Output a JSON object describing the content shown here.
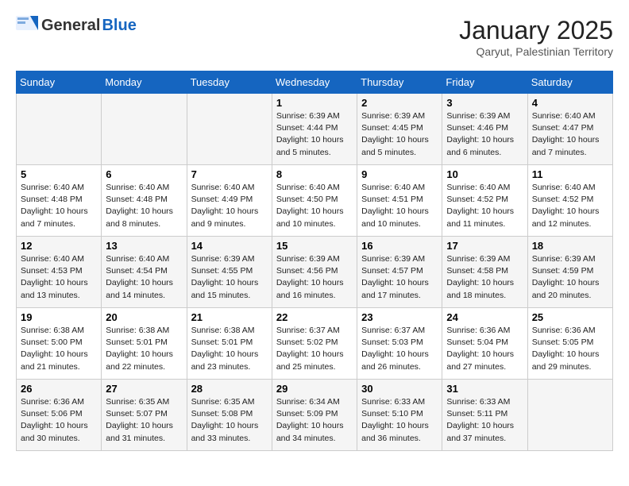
{
  "header": {
    "logo_general": "General",
    "logo_blue": "Blue",
    "month": "January 2025",
    "location": "Qaryut, Palestinian Territory"
  },
  "days_of_week": [
    "Sunday",
    "Monday",
    "Tuesday",
    "Wednesday",
    "Thursday",
    "Friday",
    "Saturday"
  ],
  "weeks": [
    [
      {
        "day": "",
        "info": ""
      },
      {
        "day": "",
        "info": ""
      },
      {
        "day": "",
        "info": ""
      },
      {
        "day": "1",
        "info": "Sunrise: 6:39 AM\nSunset: 4:44 PM\nDaylight: 10 hours\nand 5 minutes."
      },
      {
        "day": "2",
        "info": "Sunrise: 6:39 AM\nSunset: 4:45 PM\nDaylight: 10 hours\nand 5 minutes."
      },
      {
        "day": "3",
        "info": "Sunrise: 6:39 AM\nSunset: 4:46 PM\nDaylight: 10 hours\nand 6 minutes."
      },
      {
        "day": "4",
        "info": "Sunrise: 6:40 AM\nSunset: 4:47 PM\nDaylight: 10 hours\nand 7 minutes."
      }
    ],
    [
      {
        "day": "5",
        "info": "Sunrise: 6:40 AM\nSunset: 4:48 PM\nDaylight: 10 hours\nand 7 minutes."
      },
      {
        "day": "6",
        "info": "Sunrise: 6:40 AM\nSunset: 4:48 PM\nDaylight: 10 hours\nand 8 minutes."
      },
      {
        "day": "7",
        "info": "Sunrise: 6:40 AM\nSunset: 4:49 PM\nDaylight: 10 hours\nand 9 minutes."
      },
      {
        "day": "8",
        "info": "Sunrise: 6:40 AM\nSunset: 4:50 PM\nDaylight: 10 hours\nand 10 minutes."
      },
      {
        "day": "9",
        "info": "Sunrise: 6:40 AM\nSunset: 4:51 PM\nDaylight: 10 hours\nand 10 minutes."
      },
      {
        "day": "10",
        "info": "Sunrise: 6:40 AM\nSunset: 4:52 PM\nDaylight: 10 hours\nand 11 minutes."
      },
      {
        "day": "11",
        "info": "Sunrise: 6:40 AM\nSunset: 4:52 PM\nDaylight: 10 hours\nand 12 minutes."
      }
    ],
    [
      {
        "day": "12",
        "info": "Sunrise: 6:40 AM\nSunset: 4:53 PM\nDaylight: 10 hours\nand 13 minutes."
      },
      {
        "day": "13",
        "info": "Sunrise: 6:40 AM\nSunset: 4:54 PM\nDaylight: 10 hours\nand 14 minutes."
      },
      {
        "day": "14",
        "info": "Sunrise: 6:39 AM\nSunset: 4:55 PM\nDaylight: 10 hours\nand 15 minutes."
      },
      {
        "day": "15",
        "info": "Sunrise: 6:39 AM\nSunset: 4:56 PM\nDaylight: 10 hours\nand 16 minutes."
      },
      {
        "day": "16",
        "info": "Sunrise: 6:39 AM\nSunset: 4:57 PM\nDaylight: 10 hours\nand 17 minutes."
      },
      {
        "day": "17",
        "info": "Sunrise: 6:39 AM\nSunset: 4:58 PM\nDaylight: 10 hours\nand 18 minutes."
      },
      {
        "day": "18",
        "info": "Sunrise: 6:39 AM\nSunset: 4:59 PM\nDaylight: 10 hours\nand 20 minutes."
      }
    ],
    [
      {
        "day": "19",
        "info": "Sunrise: 6:38 AM\nSunset: 5:00 PM\nDaylight: 10 hours\nand 21 minutes."
      },
      {
        "day": "20",
        "info": "Sunrise: 6:38 AM\nSunset: 5:01 PM\nDaylight: 10 hours\nand 22 minutes."
      },
      {
        "day": "21",
        "info": "Sunrise: 6:38 AM\nSunset: 5:01 PM\nDaylight: 10 hours\nand 23 minutes."
      },
      {
        "day": "22",
        "info": "Sunrise: 6:37 AM\nSunset: 5:02 PM\nDaylight: 10 hours\nand 25 minutes."
      },
      {
        "day": "23",
        "info": "Sunrise: 6:37 AM\nSunset: 5:03 PM\nDaylight: 10 hours\nand 26 minutes."
      },
      {
        "day": "24",
        "info": "Sunrise: 6:36 AM\nSunset: 5:04 PM\nDaylight: 10 hours\nand 27 minutes."
      },
      {
        "day": "25",
        "info": "Sunrise: 6:36 AM\nSunset: 5:05 PM\nDaylight: 10 hours\nand 29 minutes."
      }
    ],
    [
      {
        "day": "26",
        "info": "Sunrise: 6:36 AM\nSunset: 5:06 PM\nDaylight: 10 hours\nand 30 minutes."
      },
      {
        "day": "27",
        "info": "Sunrise: 6:35 AM\nSunset: 5:07 PM\nDaylight: 10 hours\nand 31 minutes."
      },
      {
        "day": "28",
        "info": "Sunrise: 6:35 AM\nSunset: 5:08 PM\nDaylight: 10 hours\nand 33 minutes."
      },
      {
        "day": "29",
        "info": "Sunrise: 6:34 AM\nSunset: 5:09 PM\nDaylight: 10 hours\nand 34 minutes."
      },
      {
        "day": "30",
        "info": "Sunrise: 6:33 AM\nSunset: 5:10 PM\nDaylight: 10 hours\nand 36 minutes."
      },
      {
        "day": "31",
        "info": "Sunrise: 6:33 AM\nSunset: 5:11 PM\nDaylight: 10 hours\nand 37 minutes."
      },
      {
        "day": "",
        "info": ""
      }
    ]
  ]
}
